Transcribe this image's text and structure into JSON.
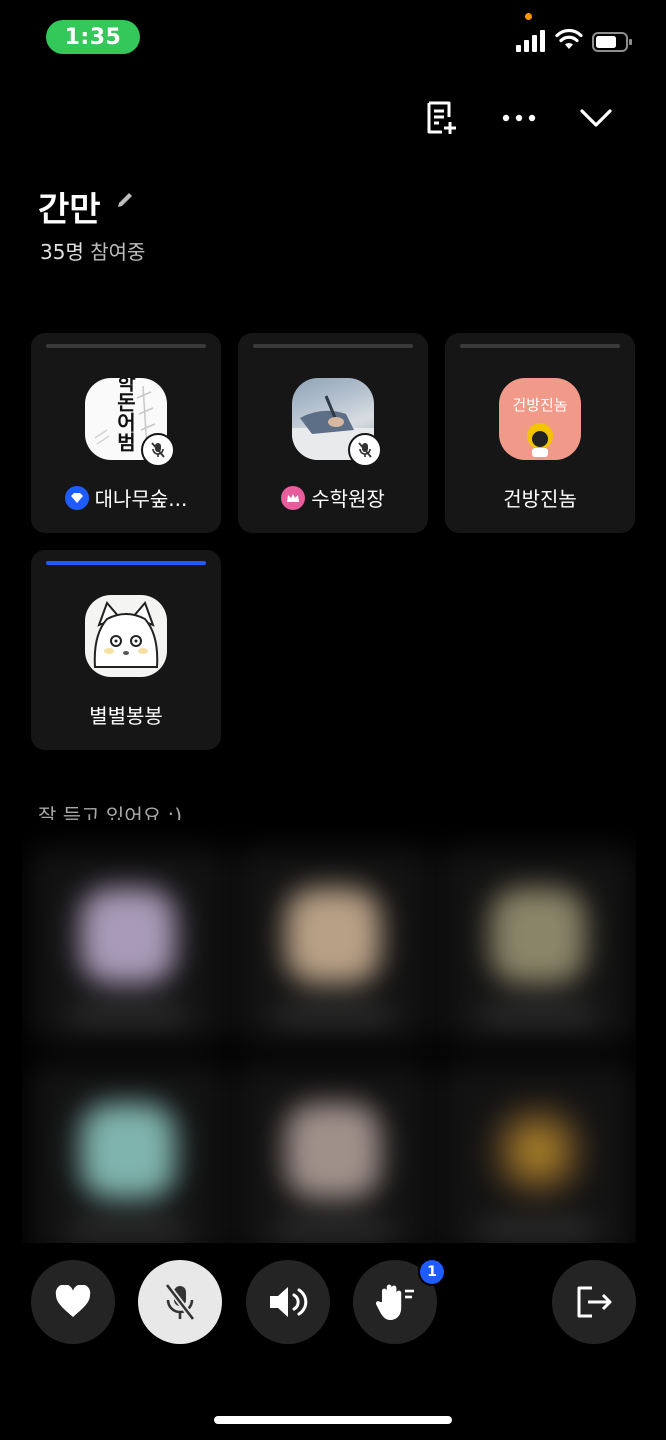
{
  "status_bar": {
    "time": "1:35"
  },
  "room": {
    "title": "간만",
    "participant_count": "35명",
    "participant_suffix": "참여중"
  },
  "speakers": [
    {
      "name": "대나무숲...",
      "role": "host",
      "role_color": "#1e5cff",
      "muted": true,
      "active": false
    },
    {
      "name": "수학원장",
      "role": "co-host",
      "role_color": "#e85d9c",
      "muted": true,
      "active": false
    },
    {
      "name": "건방진놈",
      "role": "",
      "muted": false,
      "active": false,
      "avatar_text": "건방진놈"
    },
    {
      "name": "별별봉봉",
      "role": "",
      "muted": false,
      "active": true
    }
  ],
  "avatar1_text": "학돈어범",
  "listeners_label": "잘 듣고 있어요 :)",
  "controls": {
    "raise_hand_count": "1"
  },
  "colors": {
    "accent": "#1e5cff",
    "status_green": "#34c759"
  }
}
